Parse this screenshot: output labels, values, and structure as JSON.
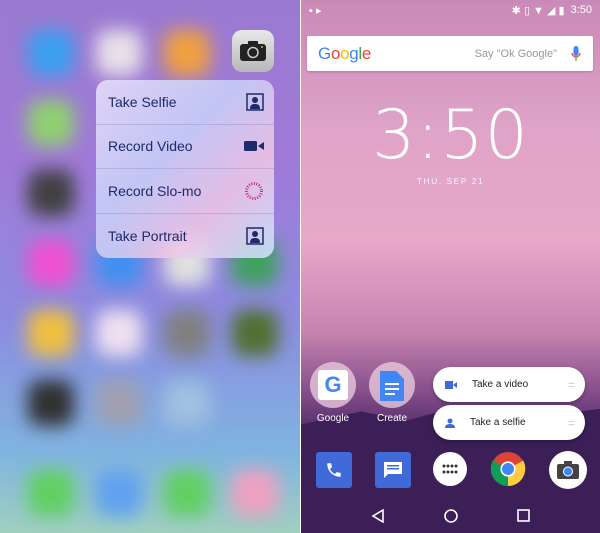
{
  "ios": {
    "menu": [
      {
        "label": "Take Selfie",
        "icon": "selfie-portrait-icon"
      },
      {
        "label": "Record Video",
        "icon": "video-camera-icon"
      },
      {
        "label": "Record Slo-mo",
        "icon": "slomo-icon"
      },
      {
        "label": "Take Portrait",
        "icon": "portrait-icon"
      }
    ]
  },
  "android": {
    "status_time": "3:50",
    "search": {
      "logo": "Google",
      "hint": "Say \"Ok Google\""
    },
    "clock": "3:50",
    "date": "THU, SEP 21",
    "apps": [
      {
        "label": "Google"
      },
      {
        "label": "Create"
      }
    ],
    "shortcuts": [
      {
        "label": "Take a video",
        "icon": "video-icon"
      },
      {
        "label": "Take a selfie",
        "icon": "person-icon"
      }
    ],
    "dock": [
      "phone-icon",
      "messages-icon",
      "app-drawer-icon",
      "chrome-icon",
      "camera-icon"
    ]
  }
}
